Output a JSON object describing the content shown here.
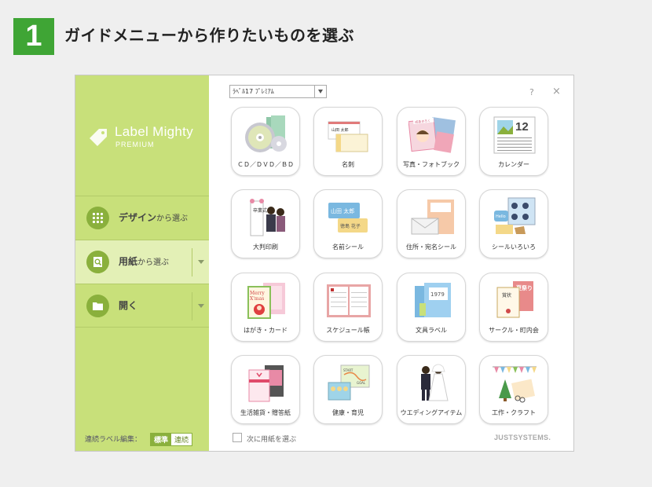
{
  "step": {
    "number": "1",
    "title": "ガイドメニューから作りたいものを選ぶ"
  },
  "logo": {
    "name": "Label Mighty",
    "edition": "PREMIUM",
    "icon": "tag-icon"
  },
  "sidebar": {
    "items": [
      {
        "label": "デザイン",
        "suffix": "から選ぶ",
        "icon": "grid-icon",
        "active": false,
        "has_dropdown": false
      },
      {
        "label": "用紙",
        "suffix": "から選ぶ",
        "icon": "paper-search-icon",
        "active": true,
        "has_dropdown": true
      },
      {
        "label": "開く",
        "suffix": "",
        "icon": "folder-icon",
        "active": false,
        "has_dropdown": true
      }
    ],
    "continuous": {
      "label": "連続ラベル編集：",
      "options": [
        "標準",
        "連続"
      ],
      "selected": "標準"
    }
  },
  "toolbar": {
    "select_value": "ﾗﾍﾞﾙ17 ﾌﾟﾚﾐｱﾑ",
    "help": "?",
    "close": "×"
  },
  "tiles": [
    {
      "label": "ＣＤ／ＤＶＤ／ＢＤ",
      "icon": "cd-dvd-icon"
    },
    {
      "label": "名刺",
      "icon": "business-card-icon"
    },
    {
      "label": "写真・フォトブック",
      "icon": "photo-book-icon"
    },
    {
      "label": "カレンダー",
      "icon": "calendar-icon"
    },
    {
      "label": "大判印刷",
      "icon": "large-print-icon"
    },
    {
      "label": "名前シール",
      "icon": "name-sticker-icon"
    },
    {
      "label": "住所・宛名シール",
      "icon": "address-label-icon"
    },
    {
      "label": "シールいろいろ",
      "icon": "stickers-icon"
    },
    {
      "label": "はがき・カード",
      "icon": "postcard-icon"
    },
    {
      "label": "スケジュール帳",
      "icon": "schedule-book-icon"
    },
    {
      "label": "文具ラベル",
      "icon": "stationery-label-icon"
    },
    {
      "label": "サークル・町内会",
      "icon": "circle-community-icon"
    },
    {
      "label": "生活雑貨・贈答紙",
      "icon": "gift-wrap-icon"
    },
    {
      "label": "健康・育児",
      "icon": "health-childcare-icon"
    },
    {
      "label": "ウエディングアイテム",
      "icon": "wedding-icon"
    },
    {
      "label": "工作・クラフト",
      "icon": "craft-icon"
    }
  ],
  "tile_texts": {
    "card_name": "山田 太郎",
    "card_name2": "徳島 花子",
    "calendar_day": "12",
    "photo_title": "成長きろく",
    "postcard_text1": "Merry",
    "postcard_text2": "X'mas",
    "large_print_text": "卒業式",
    "year_label": "1979",
    "circle_text1": "賞状",
    "circle_text2": "夏祭り",
    "hello_text": "Hello",
    "start_text": "START",
    "goal_text": "GOAL"
  },
  "footer": {
    "next_checkbox_label": "次に用紙を選ぶ",
    "brand": "JUSTSYSTEMS."
  },
  "colors": {
    "accent_green": "#3fa535",
    "sidebar_bg": "#c8e07a",
    "sidebar_active": "#e3f0b6",
    "icon_circle": "#8ab03c"
  }
}
